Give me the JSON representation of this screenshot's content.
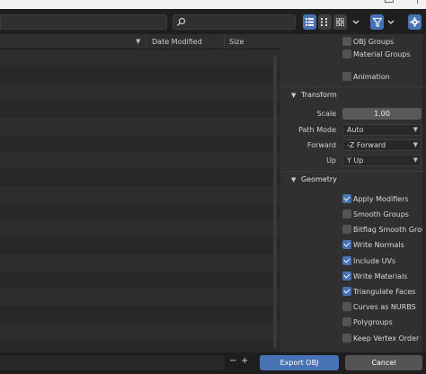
{
  "file_list": {
    "columns": [
      "Date Modified",
      "Size"
    ]
  },
  "panel": {
    "top_items": [
      {
        "label": "OBJ Groups",
        "checked": false
      },
      {
        "label": "Material Groups",
        "checked": false
      },
      {
        "label": "Animation",
        "checked": false
      }
    ],
    "transform": {
      "title": "Transform",
      "scale_label": "Scale",
      "scale_value": "1.00",
      "path_mode_label": "Path Mode",
      "path_mode_value": "Auto",
      "forward_label": "Forward",
      "forward_value": "-Z Forward",
      "up_label": "Up",
      "up_value": "Y Up"
    },
    "geometry": {
      "title": "Geometry",
      "items": [
        {
          "label": "Apply Modifiers",
          "checked": true
        },
        {
          "label": "Smooth Groups",
          "checked": false
        },
        {
          "label": "Bitflag Smooth Grou...",
          "checked": false
        },
        {
          "label": "Write Normals",
          "checked": true
        },
        {
          "label": "Include UVs",
          "checked": true
        },
        {
          "label": "Write Materials",
          "checked": true
        },
        {
          "label": "Triangulate Faces",
          "checked": true
        },
        {
          "label": "Curves as NURBS",
          "checked": false
        },
        {
          "label": "Polygroups",
          "checked": false
        },
        {
          "label": "Keep Vertex Order",
          "checked": false
        }
      ]
    }
  },
  "footer": {
    "minus": "−",
    "plus": "+",
    "export_label": "Export OBJ",
    "cancel_label": "Cancel"
  },
  "colors": {
    "accent": "#4772b3",
    "background": "#2b2b2b"
  }
}
